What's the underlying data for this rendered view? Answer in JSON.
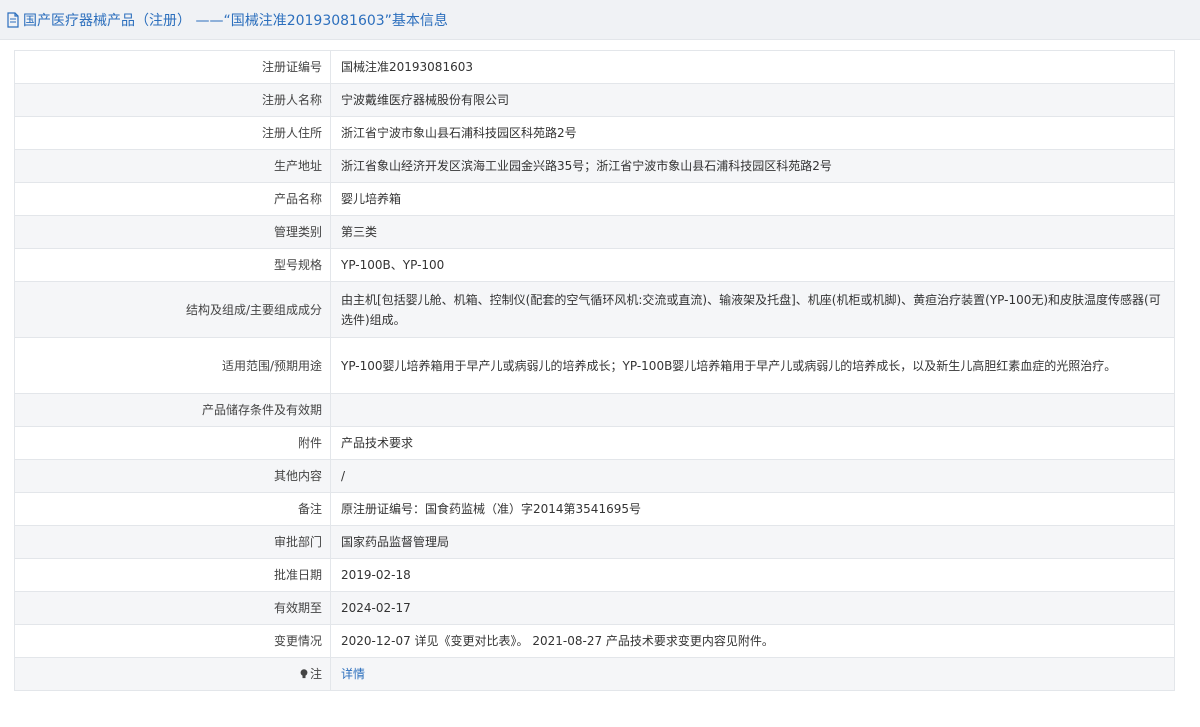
{
  "header": {
    "title": "国产医疗器械产品（注册） ——“国械注准20193081603”基本信息"
  },
  "rows": [
    {
      "label": "注册证编号",
      "value": "国械注准20193081603"
    },
    {
      "label": "注册人名称",
      "value": "宁波戴维医疗器械股份有限公司"
    },
    {
      "label": "注册人住所",
      "value": "浙江省宁波市象山县石浦科技园区科苑路2号"
    },
    {
      "label": "生产地址",
      "value": "浙江省象山经济开发区滨海工业园金兴路35号；浙江省宁波市象山县石浦科技园区科苑路2号"
    },
    {
      "label": "产品名称",
      "value": "婴儿培养箱"
    },
    {
      "label": "管理类别",
      "value": "第三类"
    },
    {
      "label": "型号规格",
      "value": "YP-100B、YP-100"
    },
    {
      "label": "结构及组成/主要组成成分",
      "value": "由主机[包括婴儿舱、机箱、控制仪(配套的空气循环风机:交流或直流)、输液架及托盘]、机座(机柜或机脚)、黄疸治疗装置(YP-100无)和皮肤温度传感器(可选件)组成。"
    },
    {
      "label": "适用范围/预期用途",
      "value": "YP-100婴儿培养箱用于早产儿或病弱儿的培养成长；YP-100B婴儿培养箱用于早产儿或病弱儿的培养成长，以及新生儿高胆红素血症的光照治疗。"
    },
    {
      "label": "产品储存条件及有效期",
      "value": ""
    },
    {
      "label": "附件",
      "value": "产品技术要求"
    },
    {
      "label": "其他内容",
      "value": "/"
    },
    {
      "label": "备注",
      "value": "原注册证编号：国食药监械（准）字2014第3541695号"
    },
    {
      "label": "审批部门",
      "value": "国家药品监督管理局"
    },
    {
      "label": "批准日期",
      "value": "2019-02-18"
    },
    {
      "label": "有效期至",
      "value": "2024-02-17"
    },
    {
      "label": "变更情况",
      "value": "2020-12-07 详见《变更对比表》。 2021-08-27 产品技术要求变更内容见附件。"
    },
    {
      "label": "注",
      "value": "详情"
    }
  ],
  "icons": {
    "header": "document-icon",
    "note": "lightbulb-icon"
  },
  "colors": {
    "header_text": "#2c6fbd",
    "link": "#2c6fbd",
    "header_bg": "#f0f2f5",
    "row_alt_bg": "#f5f6f8",
    "border": "#e3e6ea"
  }
}
